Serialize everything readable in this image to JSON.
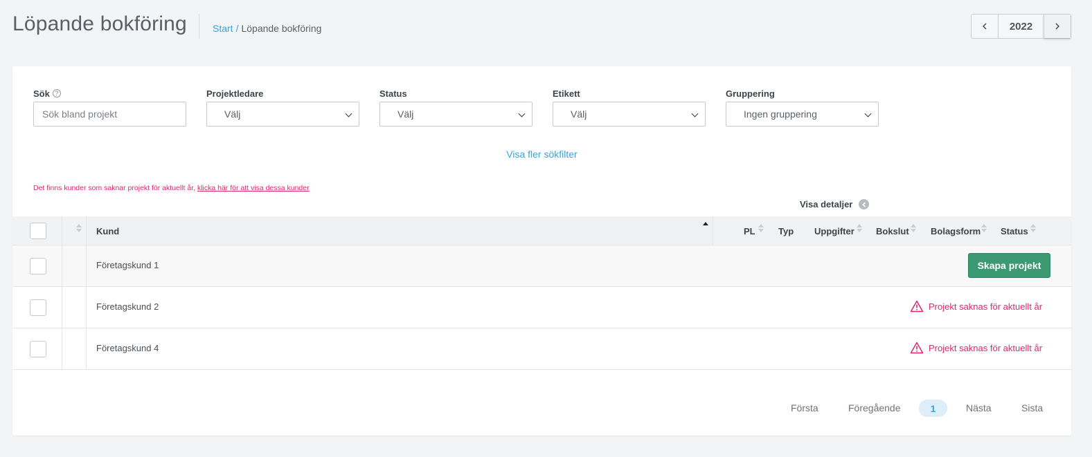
{
  "header": {
    "title": "Löpande bokföring",
    "breadcrumb": {
      "home": "Start",
      "separator": "/",
      "current": "Löpande bokföring"
    },
    "year": "2022",
    "prev_icon": "chevron-left-icon",
    "next_icon": "chevron-right-icon"
  },
  "filters": {
    "search": {
      "label": "Sök",
      "placeholder": "Sök bland projekt"
    },
    "project_lead": {
      "label": "Projektledare",
      "value": "Välj"
    },
    "status": {
      "label": "Status",
      "value": "Välj"
    },
    "tag": {
      "label": "Etikett",
      "value": "Välj"
    },
    "grouping": {
      "label": "Gruppering",
      "value": "Ingen gruppering"
    },
    "more_filters": "Visa fler sökfilter"
  },
  "warning": {
    "text": "Det finns kunder som saknar projekt för aktuellt år, ",
    "link": "klicka här för att visa dessa kunder"
  },
  "details_toggle": "Visa detaljer",
  "table": {
    "columns": {
      "kund": "Kund",
      "pl": "PL",
      "typ": "Typ",
      "uppgifter": "Uppgifter",
      "bokslut": "Bokslut",
      "bolagsform": "Bolagsform",
      "status": "Status"
    },
    "rows": [
      {
        "name": "Företagskund 1",
        "action": "Skapa projekt"
      },
      {
        "name": "Företagskund 2",
        "status": "Projekt saknas för aktuellt år"
      },
      {
        "name": "Företagskund 4",
        "status": "Projekt saknas för aktuellt år"
      }
    ]
  },
  "pagination": {
    "first": "Första",
    "prev": "Föregående",
    "current": "1",
    "next": "Nästa",
    "last": "Sista"
  },
  "colors": {
    "accent": "#3aa3d8",
    "primary_button": "#3c9a72",
    "warning": "#e0266f",
    "background": "#f3f4f6"
  }
}
